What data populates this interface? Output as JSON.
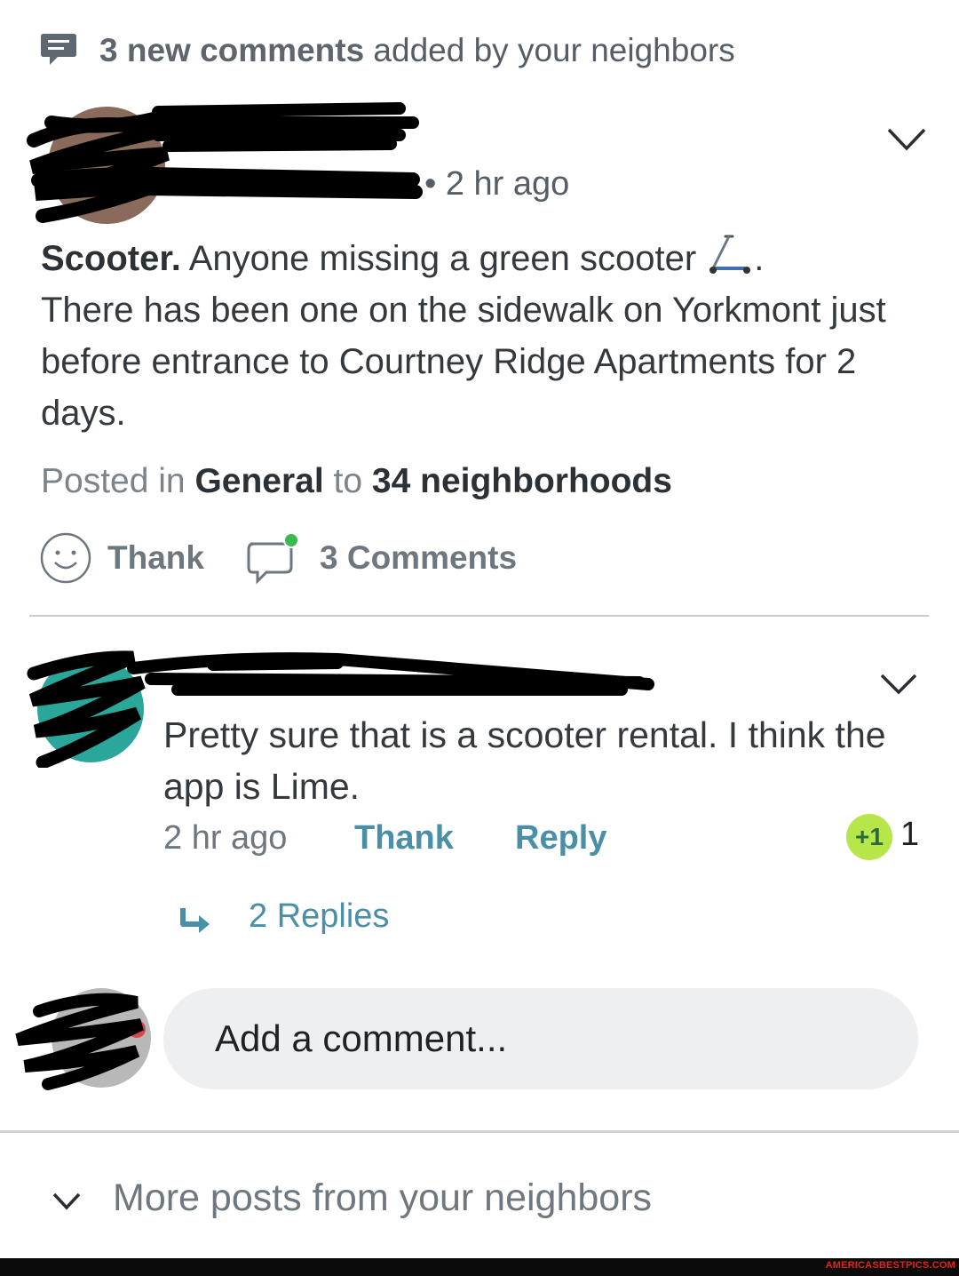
{
  "banner": {
    "count_label": "3 new comments",
    "suffix": " added by your neighbors",
    "icon": "comment-bubble-icon"
  },
  "post": {
    "time": "• 2 hr ago",
    "subject": "Scooter.",
    "body_line1": " Anyone missing a green scooter ",
    "body_after_emoji": ".",
    "body_rest": "There has been one on the sidewalk on Yorkmont just before entrance to Courtney Ridge Apartments for 2 days.",
    "emoji": "scooter-emoji",
    "posted_prefix": "Posted in ",
    "category": "General",
    "posted_mid": " to ",
    "audience": "34 neighborhoods",
    "actions": {
      "thank": "Thank",
      "comments": "3 Comments"
    }
  },
  "comment": {
    "text": "Pretty sure that is a scooter rental. I think the app is Lime.",
    "time": "2 hr ago",
    "thank": "Thank",
    "reply": "Reply",
    "plus_badge": "+1",
    "plus_count": "1",
    "replies": "2 Replies"
  },
  "composer": {
    "placeholder": "Add a comment..."
  },
  "more_posts": {
    "label": "More posts from your neighbors"
  },
  "watermark": "AMERICASBESTPICS.COM",
  "colors": {
    "link": "#4a8fa8",
    "badge": "#b7e64a",
    "online_dot": "#3cb94e",
    "redaction": "#000000"
  }
}
